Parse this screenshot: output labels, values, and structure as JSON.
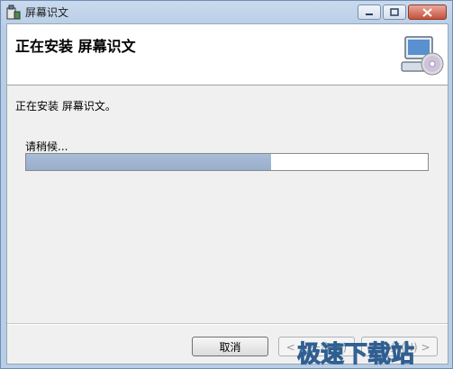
{
  "window": {
    "title": "屏幕识文",
    "minimize_icon": "minimize-icon",
    "maximize_icon": "maximize-icon",
    "close_icon": "close-icon"
  },
  "banner": {
    "heading": "正在安装 屏幕识文",
    "icon": "computer-cd-icon"
  },
  "body": {
    "status": "正在安装 屏幕识文。",
    "progress_label": "请稍候...",
    "progress_fraction": 0.61
  },
  "buttons": {
    "cancel": "取消",
    "back": "< 上一步(B)",
    "next": "下一步(N) >"
  },
  "watermark": {
    "text": "极速下载站"
  },
  "colors": {
    "progress_fill": "#98aecb",
    "titlebar": "#c9daee",
    "close_button": "#c4513b"
  }
}
